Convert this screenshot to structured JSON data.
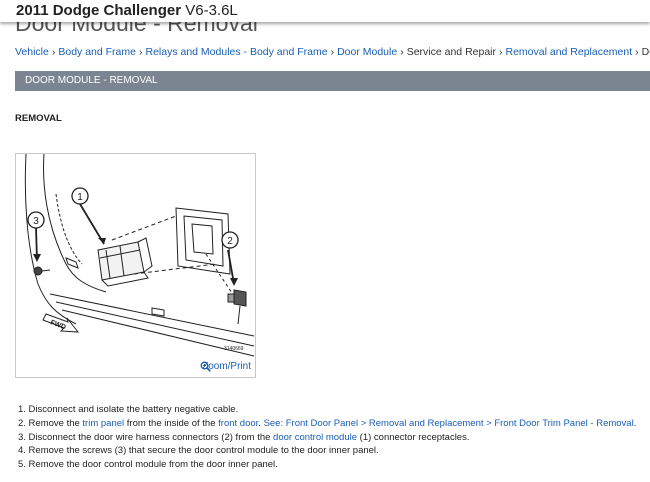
{
  "header": {
    "vehicle_bold": "2011 Dodge Challenger",
    "engine": "V6-3.6L",
    "page_title": "Door Module - Removal"
  },
  "breadcrumb": [
    {
      "label": "Vehicle",
      "link": true
    },
    {
      "label": "Body and Frame",
      "link": true
    },
    {
      "label": "Relays and Modules - Body and Frame",
      "link": true
    },
    {
      "label": "Door Module",
      "link": true
    },
    {
      "label": "Service and Repair",
      "link": false
    },
    {
      "label": "Removal and Replacement",
      "link": true
    },
    {
      "label": "Door Mo",
      "link": false
    }
  ],
  "section_title": "DOOR MODULE - REMOVAL",
  "subheading": "REMOVAL",
  "figure": {
    "callouts": [
      "1",
      "2",
      "3"
    ],
    "arrow_label": "FWD",
    "figure_id": "3140669",
    "zoom_label": "Zoom/Print",
    "zoom_icon": "magnifier-icon"
  },
  "steps": {
    "s1": {
      "text": "1. Disconnect and isolate the battery negative cable."
    },
    "s2": {
      "pre": "2. Remove the ",
      "link1": "trim panel",
      "mid": " from the inside of the ",
      "link2": "front door",
      "mid2": ". ",
      "link3": "See: Front Door Panel > Removal and Replacement > Front Door Trim Panel - Removal",
      "post": "."
    },
    "s3": {
      "pre": "3. Disconnect the door wire harness connectors (2) from the ",
      "link": "door control module",
      "post": " (1) connector receptacles."
    },
    "s4": {
      "text": "4. Remove the screws (3) that secure the door control module to the door inner panel."
    },
    "s5": {
      "text": "5. Remove the door control module from the door inner panel."
    }
  }
}
